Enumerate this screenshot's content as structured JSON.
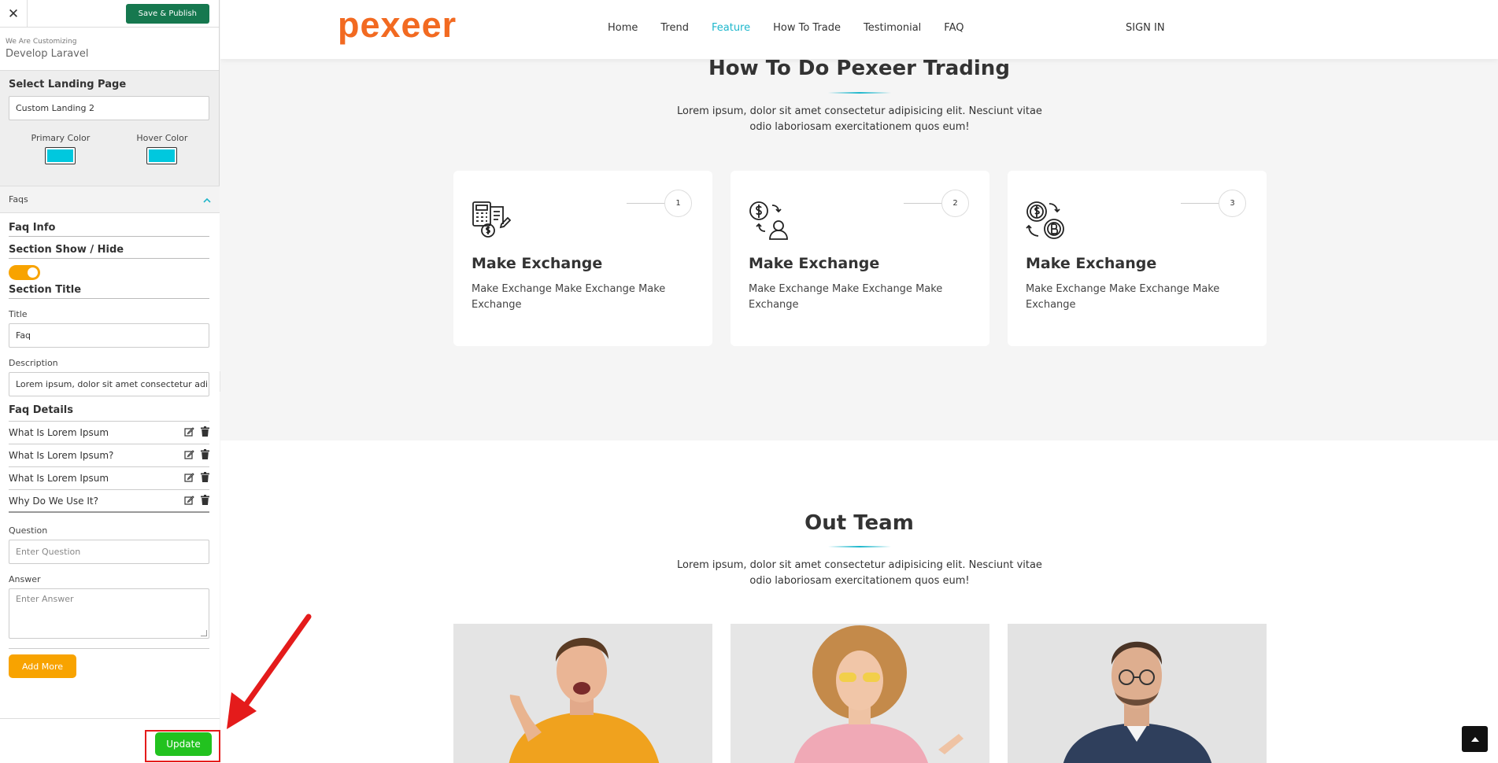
{
  "customizer": {
    "close_icon": "close-icon",
    "save_label": "Save & Publish",
    "customizing_label": "We Are Customizing",
    "theme_name": "Develop Laravel",
    "landing_label": "Select Landing Page",
    "landing_value": "Custom Landing 2",
    "primary_color_label": "Primary Color",
    "hover_color_label": "Hover Color",
    "primary_color": "#00c8de",
    "hover_color": "#00c8de",
    "accordion_title": "Faqs",
    "faq_info": "Faq Info",
    "section_show_hide": "Section Show / Hide",
    "section_title": "Section Title",
    "title_label": "Title",
    "title_value": "Faq",
    "description_label": "Description",
    "description_value": "Lorem ipsum, dolor sit amet consectetur adipisicing elit.",
    "faq_details": "Faq Details",
    "faq_items": [
      "What Is Lorem Ipsum",
      "What Is Lorem Ipsum?",
      "What Is Lorem Ipsum",
      "Why Do We Use It?"
    ],
    "question_label": "Question",
    "question_placeholder": "Enter Question",
    "answer_label": "Answer",
    "answer_placeholder": "Enter Answer",
    "add_more_label": "Add More",
    "update_label": "Update"
  },
  "site": {
    "logo": "pexeer",
    "nav": [
      "Home",
      "Trend",
      "Feature",
      "How To Trade",
      "Testimonial",
      "FAQ"
    ],
    "active_nav": "Feature",
    "signin": "SIGN IN",
    "accent_color": "#1db7cc",
    "brand_color": "#f26a21",
    "how_to": {
      "title": "How To Do Pexeer Trading",
      "description": "Lorem ipsum, dolor sit amet consectetur adipisicing elit. Nesciunt vitae odio laboriosam exercitationem quos eum!",
      "cards": [
        {
          "num": "1",
          "title": "Make Exchange",
          "text": "Make Exchange Make Exchange Make Exchange",
          "icon": "calculator-document-icon"
        },
        {
          "num": "2",
          "title": "Make Exchange",
          "text": "Make Exchange Make Exchange Make Exchange",
          "icon": "money-user-exchange-icon"
        },
        {
          "num": "3",
          "title": "Make Exchange",
          "text": "Make Exchange Make Exchange Make Exchange",
          "icon": "dollar-bitcoin-exchange-icon"
        }
      ]
    },
    "team": {
      "title": "Out Team",
      "description": "Lorem ipsum, dolor sit amet consectetur adipisicing elit. Nesciunt vitae odio laboriosam exercitationem quos eum!"
    }
  }
}
